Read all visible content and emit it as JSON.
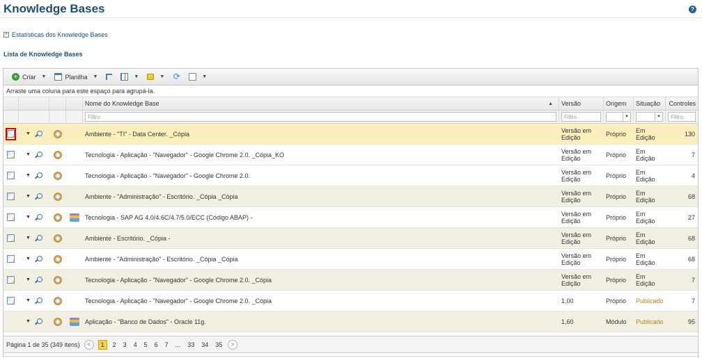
{
  "page": {
    "title": "Knowledge Bases",
    "help": "?"
  },
  "stats_section": {
    "label": "Estatísticas dos Knowledge Bases",
    "expand_glyph": "+"
  },
  "list_section": {
    "title": "Lista de Knowledge Bases"
  },
  "toolbar": {
    "create_label": "Criar",
    "spreadsheet_label": "Planilha"
  },
  "group_hint": "Arraste uma coluna para este espaço para agrupá-la.",
  "columns": {
    "name": "Nome do Knowledge Base",
    "version": "Versão",
    "origin": "Origem",
    "status": "Situação",
    "controls": "Controles"
  },
  "filters": {
    "name_placeholder": "Filtro",
    "version_placeholder": "Filtro",
    "controls_placeholder": "Filtro"
  },
  "rows": [
    {
      "name": "Ambiente - \"TI\" - Data Center. _Cópia",
      "version": "Versão em Edição",
      "origin": "Próprio",
      "status": "Em Edição",
      "controls": "130"
    },
    {
      "name": "Tecnologia - Aplicação - \"Navegador\" - Google Chrome 2.0. _Cópia_KO",
      "version": "Versão em Edição",
      "origin": "Próprio",
      "status": "Em Edição",
      "controls": "7"
    },
    {
      "name": "Tecnologia - Aplicação - \"Navegador\" - Google Chrome 2.0.",
      "version": "Versão em Edição",
      "origin": "Próprio",
      "status": "Em Edição",
      "controls": "4"
    },
    {
      "name": "Ambiente - \"Administração\" - Escritório. _Cópia _Cópia",
      "version": "Versão em Edição",
      "origin": "Próprio",
      "status": "Em Edição",
      "controls": "68"
    },
    {
      "name": "Tecnologia - SAP AG 4.0/4.6C/4.7/5.0/ECC (Código ABAP) -",
      "version": "Versão em Edição",
      "origin": "Próprio",
      "status": "Em Edição",
      "controls": "27"
    },
    {
      "name": "Ambiente - Escritório. _Cópia -",
      "version": "Versão em Edição",
      "origin": "Próprio",
      "status": "Em Edição",
      "controls": "68"
    },
    {
      "name": "Ambiente - \"Administração\" - Escritório. _Cópia _Cópia",
      "version": "Versão em Edição",
      "origin": "Próprio",
      "status": "Em Edição",
      "controls": "68"
    },
    {
      "name": "Tecnologia - Aplicação - \"Navegador\" - Google Chrome 2.0. _Cópia",
      "version": "Versão em Edição",
      "origin": "Próprio",
      "status": "Em Edição",
      "controls": "7"
    },
    {
      "name": "Tecnologia - Aplicação - \"Navegador\" - Google Chrome 2.0. _Cópia",
      "version": "1,00",
      "origin": "Próprio",
      "status": "Publicado",
      "controls": "7"
    },
    {
      "name": "Aplicação - \"Banco de Dados\" - Oracle 11g.",
      "version": "1,60",
      "origin": "Módulo",
      "status": "Publicado",
      "controls": "95"
    }
  ],
  "pager": {
    "summary": "Página 1 de 35 (349 itens)",
    "prev": "<",
    "next": ">",
    "p1": "1",
    "p2": "2",
    "p3": "3",
    "p4": "4",
    "p5": "5",
    "p6": "6",
    "p7": "7",
    "ellipsis": "...",
    "p33": "33",
    "p34": "34",
    "p35": "35"
  }
}
